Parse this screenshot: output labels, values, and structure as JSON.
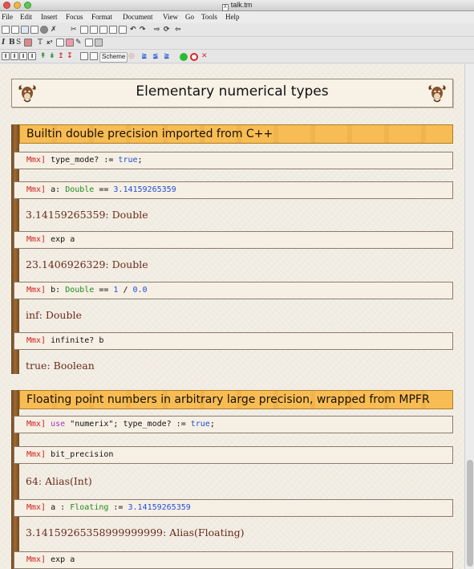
{
  "window": {
    "title": "talk.tm"
  },
  "menu": [
    "File",
    "Edit",
    "Insert",
    "Focus",
    "Format",
    "Document",
    "View",
    "Go",
    "Tools",
    "Help"
  ],
  "toolbar3": {
    "scheme_label": "Scheme"
  },
  "doc": {
    "title": "Elementary numerical types",
    "sections": [
      {
        "title": "Builtin double precision imported from C++",
        "cells": [
          {
            "prompt": "Mmx]",
            "input": [
              {
                "t": "type_mode? := ",
                "c": ""
              },
              {
                "t": "true",
                "c": "b"
              },
              {
                "t": ";",
                "c": ""
              }
            ],
            "output": ""
          },
          {
            "prompt": "Mmx]",
            "input": [
              {
                "t": "a: ",
                "c": ""
              },
              {
                "t": "Double",
                "c": "g"
              },
              {
                "t": " == ",
                "c": ""
              },
              {
                "t": "3.14159265359",
                "c": "b"
              }
            ],
            "output": "3.14159265359: Double"
          },
          {
            "prompt": "Mmx]",
            "input": [
              {
                "t": "exp a",
                "c": ""
              }
            ],
            "output": "23.1406926329: Double"
          },
          {
            "prompt": "Mmx]",
            "input": [
              {
                "t": "b: ",
                "c": ""
              },
              {
                "t": "Double",
                "c": "g"
              },
              {
                "t": " == ",
                "c": ""
              },
              {
                "t": "1",
                "c": "b"
              },
              {
                "t": " / ",
                "c": ""
              },
              {
                "t": "0.0",
                "c": "b"
              }
            ],
            "output": "inf: Double"
          },
          {
            "prompt": "Mmx]",
            "input": [
              {
                "t": "infinite? b",
                "c": ""
              }
            ],
            "output": "true: Boolean"
          }
        ]
      },
      {
        "title": "Floating point numbers in arbitrary large precision, wrapped from MPFR",
        "cells": [
          {
            "prompt": "Mmx]",
            "input": [
              {
                "t": "use ",
                "c": "p"
              },
              {
                "t": "\"numerix\"; type_mode? := ",
                "c": ""
              },
              {
                "t": "true",
                "c": "b"
              },
              {
                "t": ";",
                "c": ""
              }
            ],
            "output": ""
          },
          {
            "prompt": "Mmx]",
            "input": [
              {
                "t": "bit_precision",
                "c": ""
              }
            ],
            "output": "64: Alias(Int)"
          },
          {
            "prompt": "Mmx]",
            "input": [
              {
                "t": "a : ",
                "c": ""
              },
              {
                "t": "Floating",
                "c": "g"
              },
              {
                "t": " := ",
                "c": ""
              },
              {
                "t": "3.14159265359",
                "c": "b"
              }
            ],
            "output": "3.14159265358999999999: Alias(Floating)"
          },
          {
            "prompt": "Mmx]",
            "input": [
              {
                "t": "exp a",
                "c": ""
              }
            ],
            "output": ""
          }
        ]
      }
    ]
  }
}
